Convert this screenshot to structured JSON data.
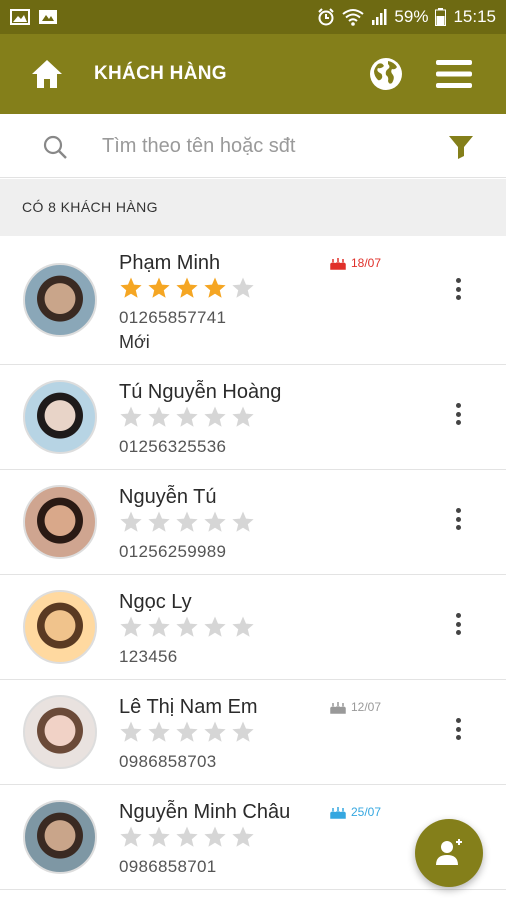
{
  "status_bar": {
    "battery": "59%",
    "time": "15:15"
  },
  "appbar": {
    "title": "KHÁCH HÀNG"
  },
  "search": {
    "placeholder": "Tìm theo tên hoặc sđt"
  },
  "count_label": "CÓ 8 KHÁCH HÀNG",
  "colors": {
    "primary": "#847f1a",
    "status": "#6e6a12",
    "star_on": "#f5a623",
    "star_off": "#d6d6d6",
    "bday_red": "#e0302a",
    "bday_gray": "#999999",
    "bday_blue": "#35a7e0"
  },
  "customers": [
    {
      "name": "Phạm Minh",
      "rating": 4,
      "phone": "01265857741",
      "note": "Mới",
      "birthday": "18/07",
      "birthday_color": "red"
    },
    {
      "name": "Tú Nguyễn Hoàng",
      "rating": 0,
      "phone": "01256325536"
    },
    {
      "name": "Nguyễn Tú",
      "rating": 0,
      "phone": "01256259989"
    },
    {
      "name": "Ngọc Ly",
      "rating": 0,
      "phone": "123456"
    },
    {
      "name": "Lê Thị Nam Em",
      "rating": 0,
      "phone": "0986858703",
      "birthday": "12/07",
      "birthday_color": "gray"
    },
    {
      "name": "Nguyễn Minh Châu",
      "rating": 0,
      "phone": "0986858701",
      "birthday": "25/07",
      "birthday_color": "blue"
    }
  ]
}
